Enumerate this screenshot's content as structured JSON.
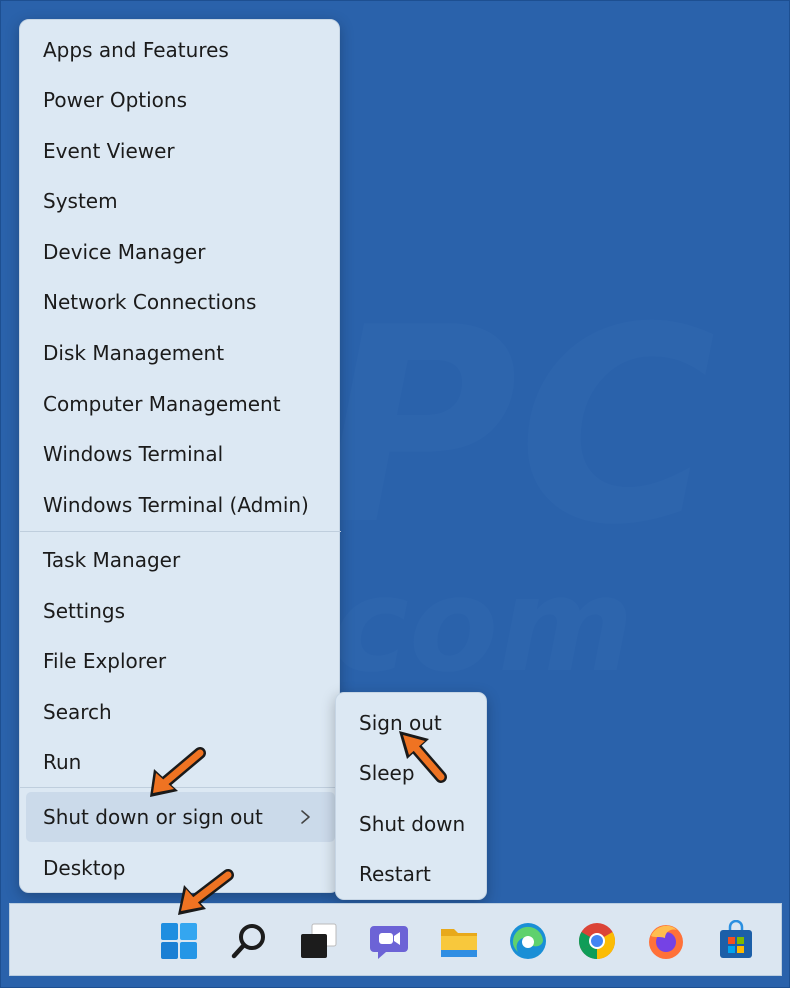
{
  "watermark": {
    "text": "risk.com"
  },
  "context_menu": {
    "items_top": [
      {
        "label": "Apps and Features"
      },
      {
        "label": "Power Options"
      },
      {
        "label": "Event Viewer"
      },
      {
        "label": "System"
      },
      {
        "label": "Device Manager"
      },
      {
        "label": "Network Connections"
      },
      {
        "label": "Disk Management"
      },
      {
        "label": "Computer Management"
      },
      {
        "label": "Windows Terminal"
      },
      {
        "label": "Windows Terminal (Admin)"
      }
    ],
    "items_bottom": [
      {
        "label": "Task Manager"
      },
      {
        "label": "Settings"
      },
      {
        "label": "File Explorer"
      },
      {
        "label": "Search"
      },
      {
        "label": "Run"
      },
      {
        "label": "Shut down or sign out",
        "has_submenu": true,
        "highlighted": true
      },
      {
        "label": "Desktop"
      }
    ]
  },
  "submenu": {
    "items": [
      {
        "label": "Sign out"
      },
      {
        "label": "Sleep"
      },
      {
        "label": "Shut down"
      },
      {
        "label": "Restart"
      }
    ]
  },
  "taskbar": {
    "icons": [
      "windows-start-icon",
      "search-icon",
      "task-view-icon",
      "teams-chat-icon",
      "file-explorer-icon",
      "edge-icon",
      "chrome-icon",
      "firefox-icon",
      "microsoft-store-icon"
    ]
  },
  "colors": {
    "desktop": "#2a62ab",
    "menu_bg": "#dce8f3",
    "highlight": "#cbdaea",
    "arrow": "#ef7322"
  }
}
